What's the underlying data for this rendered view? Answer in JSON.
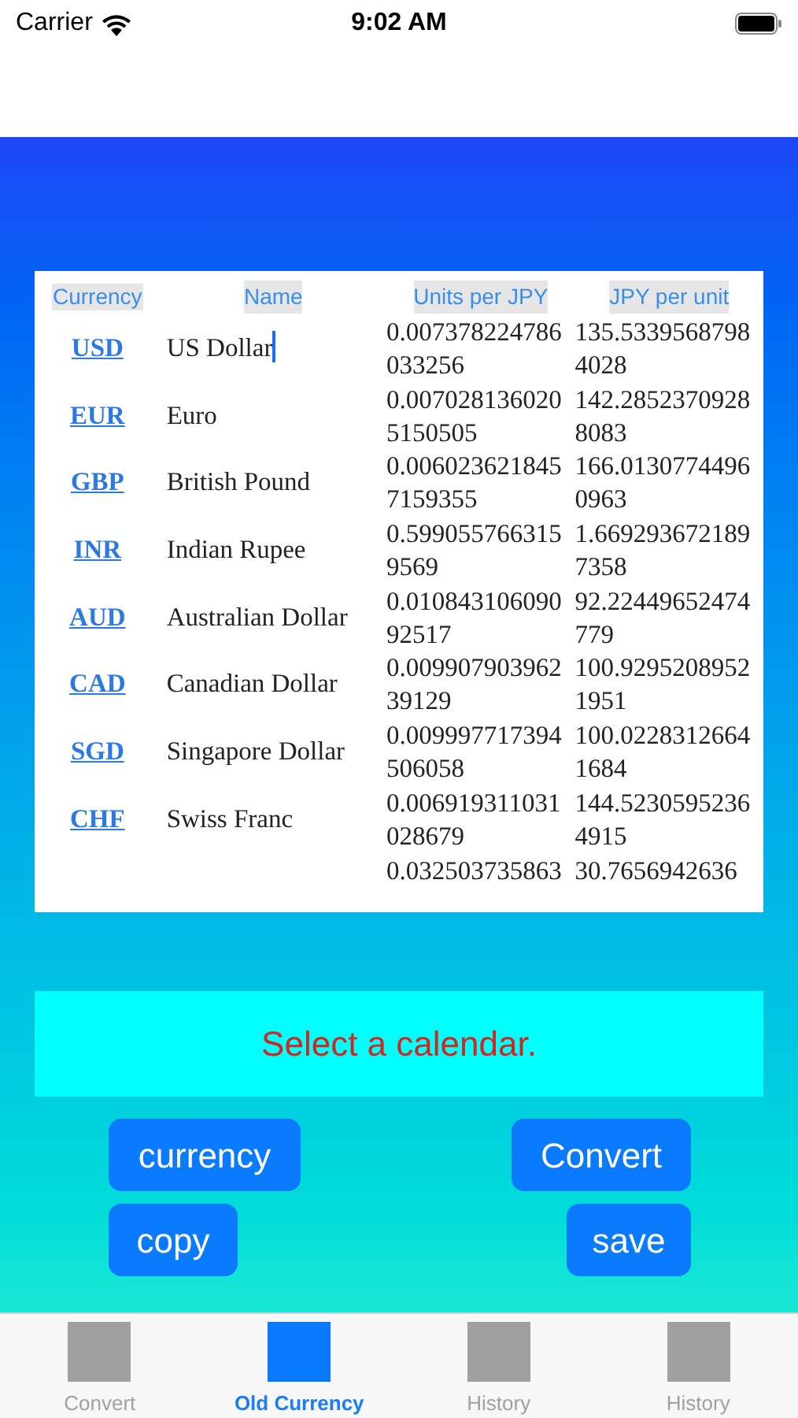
{
  "status_bar": {
    "carrier": "Carrier",
    "time": "9:02 AM"
  },
  "table": {
    "columns": [
      "Currency",
      "Name",
      "Units per JPY",
      "JPY per unit"
    ],
    "rows": [
      {
        "code": "USD",
        "name": "US Dollar",
        "units_per_jpy": "0.007378224786033256",
        "jpy_per_unit": "135.53395687984028",
        "text_cursor": true
      },
      {
        "code": "EUR",
        "name": "Euro",
        "units_per_jpy": "0.0070281360205150505",
        "jpy_per_unit": "142.28523709288083",
        "text_cursor": false
      },
      {
        "code": "GBP",
        "name": "British Pound",
        "units_per_jpy": "0.0060236218457159355",
        "jpy_per_unit": "166.01307744960963",
        "text_cursor": false
      },
      {
        "code": "INR",
        "name": "Indian Rupee",
        "units_per_jpy": "0.5990557663159569",
        "jpy_per_unit": "1.6692936721897358",
        "text_cursor": false
      },
      {
        "code": "AUD",
        "name": "Australian Dollar",
        "units_per_jpy": "0.01084310609092517",
        "jpy_per_unit": "92.22449652474779",
        "text_cursor": false
      },
      {
        "code": "CAD",
        "name": "Canadian Dollar",
        "units_per_jpy": "0.00990790396239129",
        "jpy_per_unit": "100.92952089521951",
        "text_cursor": false
      },
      {
        "code": "SGD",
        "name": "Singapore Dollar",
        "units_per_jpy": "0.009997717394506058",
        "jpy_per_unit": "100.02283126641684",
        "text_cursor": false
      },
      {
        "code": "CHF",
        "name": "Swiss Franc",
        "units_per_jpy": "0.006919311031028679",
        "jpy_per_unit": "144.52305952364915",
        "text_cursor": false
      },
      {
        "units_per_jpy": "0.032503735863",
        "jpy_per_unit": "30.7656942636",
        "text_cursor": false
      }
    ]
  },
  "message": "Select a calendar.",
  "buttons": {
    "currency": "currency",
    "convert": "Convert",
    "copy": "copy",
    "save": "save"
  },
  "tabs": [
    {
      "label": "Convert",
      "selected": false
    },
    {
      "label": "Old Currency",
      "selected": true
    },
    {
      "label": "History",
      "selected": false
    },
    {
      "label": "History",
      "selected": false
    }
  ]
}
